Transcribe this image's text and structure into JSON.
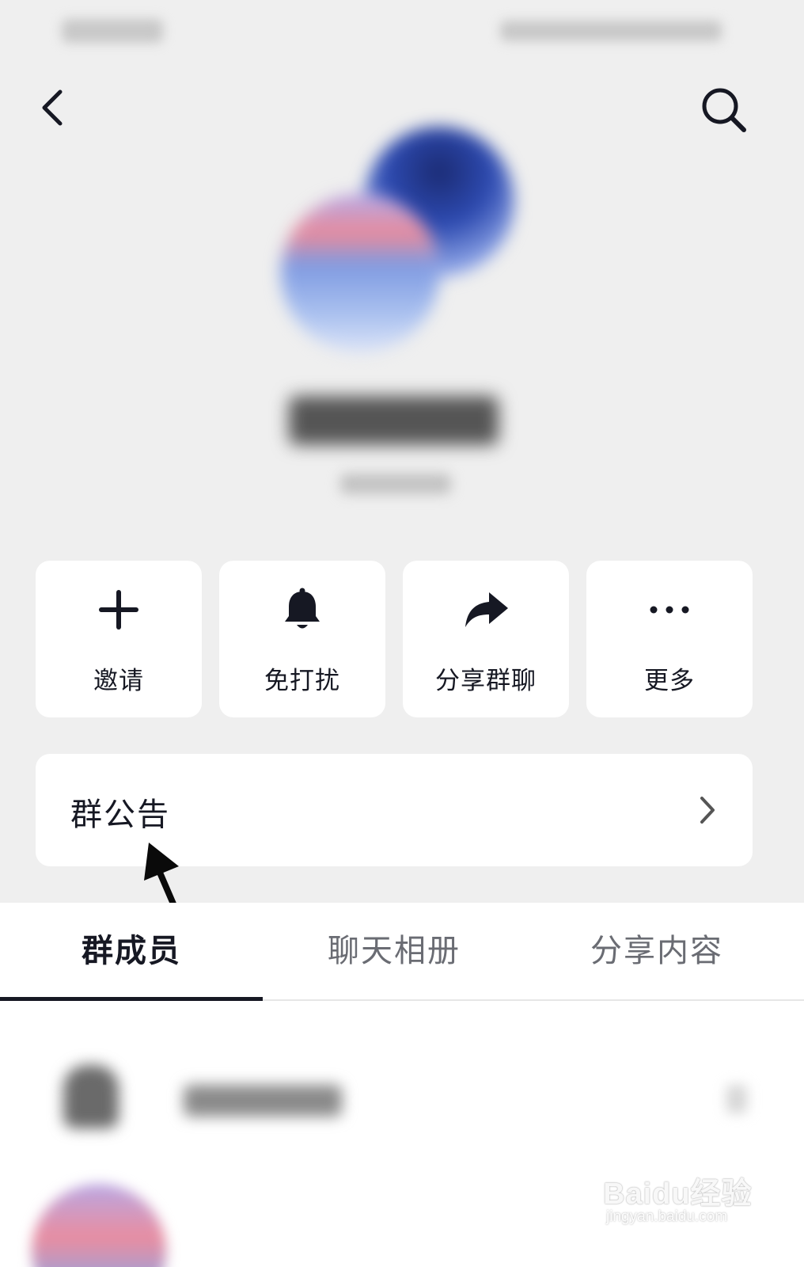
{
  "nav": {
    "back_icon": "chevron-left-icon",
    "search_icon": "search-icon"
  },
  "actions": [
    {
      "label": "邀请",
      "icon": "plus-icon"
    },
    {
      "label": "免打扰",
      "icon": "bell-icon"
    },
    {
      "label": "分享群聊",
      "icon": "share-arrow-icon"
    },
    {
      "label": "更多",
      "icon": "more-dots-icon"
    }
  ],
  "notice": {
    "label": "群公告",
    "icon": "chevron-right-icon"
  },
  "tabs": [
    {
      "label": "群成员",
      "active": true
    },
    {
      "label": "聊天相册",
      "active": false
    },
    {
      "label": "分享内容",
      "active": false
    }
  ],
  "watermark": {
    "text": "Baidu经验",
    "sub": "jingyan.baidu.com"
  },
  "colors": {
    "background": "#efefef",
    "card": "#ffffff",
    "text_primary": "#161823",
    "text_secondary": "#6a6c73"
  }
}
